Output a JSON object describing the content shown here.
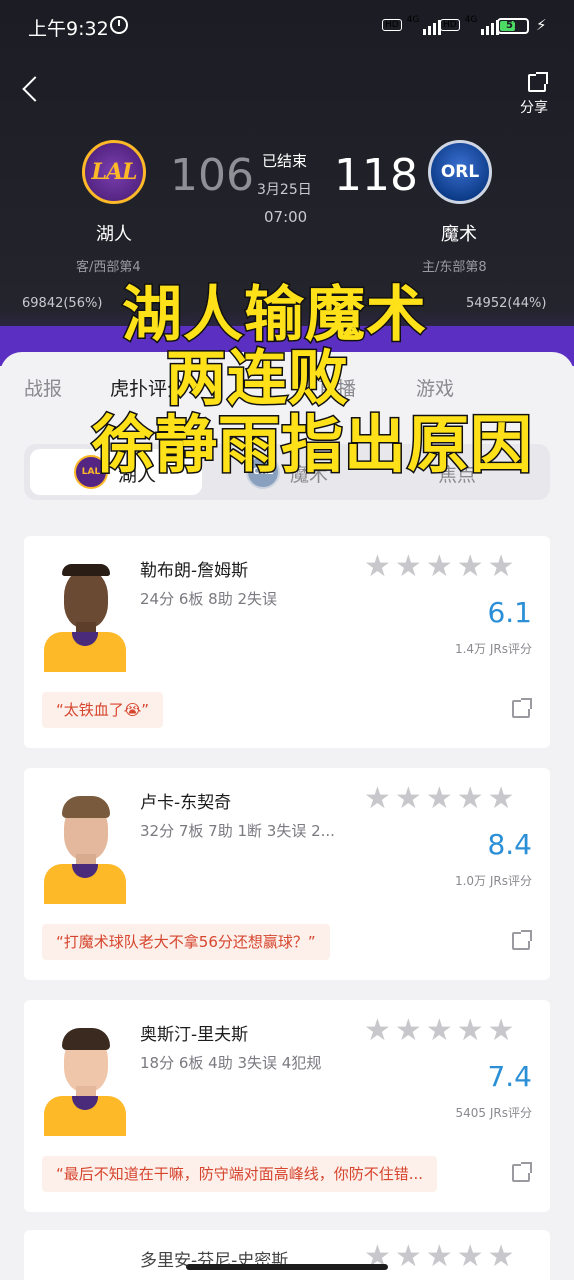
{
  "status_bar": {
    "time": "上午9:32",
    "battery": "57",
    "network": "4G"
  },
  "header": {
    "share_label": "分享"
  },
  "game": {
    "home": {
      "name": "湖人",
      "logo_text": "LAL",
      "score": "106",
      "rank": "客/西部第4",
      "vote": "69842(56%)"
    },
    "away": {
      "name": "魔术",
      "logo_text": "ORL",
      "score": "118",
      "rank": "主/东部第8",
      "vote": "54952(44%)"
    },
    "status": "已结束",
    "date": "3月25日",
    "time": "07:00"
  },
  "tabs": [
    "战报",
    "虎扑评分",
    "直播",
    "游戏"
  ],
  "segments": [
    {
      "label": "湖人",
      "logo_text": "LAL"
    },
    {
      "label": "魔术",
      "logo_text": "ORL"
    },
    {
      "label": "焦点"
    }
  ],
  "players": [
    {
      "name": "勒布朗-詹姆斯",
      "stats": "24分 6板 8助 2失误",
      "rating": "6.1",
      "rating_count": "1.4万 JRs评分",
      "quote": "“太铁血了😭”"
    },
    {
      "name": "卢卡-东契奇",
      "stats": "32分 7板 7助 1断 3失误 2...",
      "rating": "8.4",
      "rating_count": "1.0万 JRs评分",
      "quote": "“打魔术球队老大不拿56分还想赢球？”"
    },
    {
      "name": "奥斯汀-里夫斯",
      "stats": "18分 6板 4助 3失误 4犯规",
      "rating": "7.4",
      "rating_count": "5405 JRs评分",
      "quote": "“最后不知道在干嘛，防守端对面高峰线，你防不住错..."
    },
    {
      "name": "多里安-芬尼-史密斯"
    }
  ],
  "caption": {
    "line1": "湖人输魔术",
    "line2": "两连败",
    "line3": "徐静雨指出原因"
  },
  "colors": {
    "lakers_purple": "#552583",
    "lakers_gold": "#fdb927",
    "accent_purple": "#5b2fc2",
    "rating_blue": "#2a8fd6",
    "caption_yellow": "#ffe11a"
  }
}
